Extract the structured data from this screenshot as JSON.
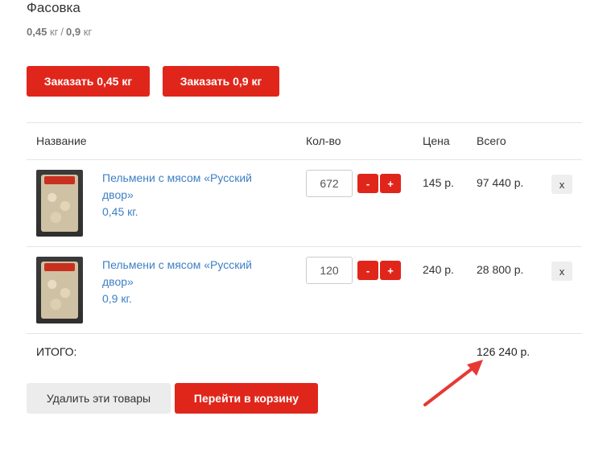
{
  "packing": {
    "title": "Фасовка",
    "option1": "0,45",
    "unit1": "кг",
    "separator": "/",
    "option2": "0,9",
    "unit2": "кг"
  },
  "order_buttons": {
    "btn1": "Заказать 0,45 кг",
    "btn2": "Заказать 0,9 кг"
  },
  "table": {
    "headers": {
      "name": "Название",
      "qty": "Кол-во",
      "price": "Цена",
      "total": "Всего"
    },
    "rows": [
      {
        "name_line1": "Пельмени с мясом «Русский",
        "name_line2": "двор»",
        "weight": "0,45 кг.",
        "qty": "672",
        "minus": "-",
        "plus": "+",
        "price": "145 р.",
        "total": "97 440 р.",
        "remove": "x"
      },
      {
        "name_line1": "Пельмени с мясом «Русский",
        "name_line2": "двор»",
        "weight": "0,9 кг.",
        "qty": "120",
        "minus": "-",
        "plus": "+",
        "price": "240 р.",
        "total": "28 800 р.",
        "remove": "x"
      }
    ]
  },
  "summary": {
    "label": "ИТОГО:",
    "value": "126 240 р."
  },
  "actions": {
    "remove_all": "Удалить эти товары",
    "go_to_cart": "Перейти в корзину"
  },
  "colors": {
    "accent": "#e0261b",
    "link": "#3d7fc4",
    "annotation_arrow": "#e53935"
  }
}
